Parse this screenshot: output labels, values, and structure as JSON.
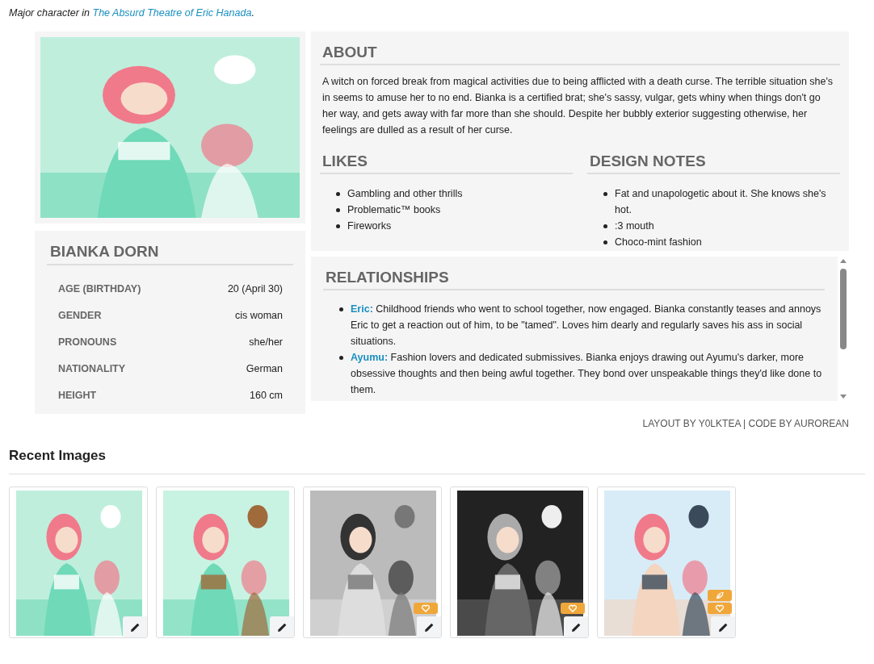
{
  "intro": {
    "text": "Major character in ",
    "link": "The Absurd Theatre of Eric Hanada",
    "end": "."
  },
  "portrait": {
    "kind": "picture"
  },
  "profile": {
    "name": "BIANKA DORN",
    "fields": [
      {
        "label": "AGE (BIRTHDAY)",
        "value": "20 (April 30)"
      },
      {
        "label": "GENDER",
        "value": "cis woman"
      },
      {
        "label": "PRONOUNS",
        "value": "she/her"
      },
      {
        "label": "NATIONALITY",
        "value": "German"
      },
      {
        "label": "HEIGHT",
        "value": "160 cm"
      }
    ]
  },
  "about": {
    "heading": "ABOUT",
    "text": "A witch on forced break from magical activities due to being afflicted with a death curse. The terrible situation she's in seems to amuse her to no end. Bianka is a certified brat; she's sassy, vulgar, gets whiny when things don't go her way, and gets away with far more than she should. Despite her bubbly exterior suggesting otherwise, her feelings are dulled as a result of her curse."
  },
  "likes": {
    "heading": "LIKES",
    "items": [
      "Gambling and other thrills",
      "Problematic™ books",
      "Fireworks"
    ]
  },
  "design_notes": {
    "heading": "DESIGN NOTES",
    "items": [
      "Fat and unapologetic about it. She knows she's hot.",
      ":3 mouth",
      "Choco-mint fashion"
    ]
  },
  "relationships": {
    "heading": "RELATIONSHIPS",
    "items": [
      {
        "name": "Eric:",
        "text": " Childhood friends who went to school together, now engaged. Bianka constantly teases and annoys Eric to get a reaction out of him, to be \"tamed\". Loves him dearly and regularly saves his ass in social situations."
      },
      {
        "name": "Ayumu:",
        "text": " Fashion lovers and dedicated submissives. Bianka enjoys drawing out Ayumu's darker, more obsessive thoughts and then being awful together. They bond over unspeakable things they'd like done to them."
      }
    ]
  },
  "credits": "LAYOUT BY Y0LKTEA | CODE BY AUROREAN",
  "recent_images": {
    "heading": "Recent Images",
    "items": [
      {
        "kind": "picture",
        "leaf": false,
        "favorite": false
      },
      {
        "kind": "picture",
        "leaf": false,
        "favorite": false
      },
      {
        "kind": "picture",
        "leaf": false,
        "favorite": true
      },
      {
        "kind": "picture",
        "leaf": false,
        "favorite": true
      },
      {
        "kind": "picture",
        "leaf": true,
        "favorite": true
      }
    ]
  }
}
